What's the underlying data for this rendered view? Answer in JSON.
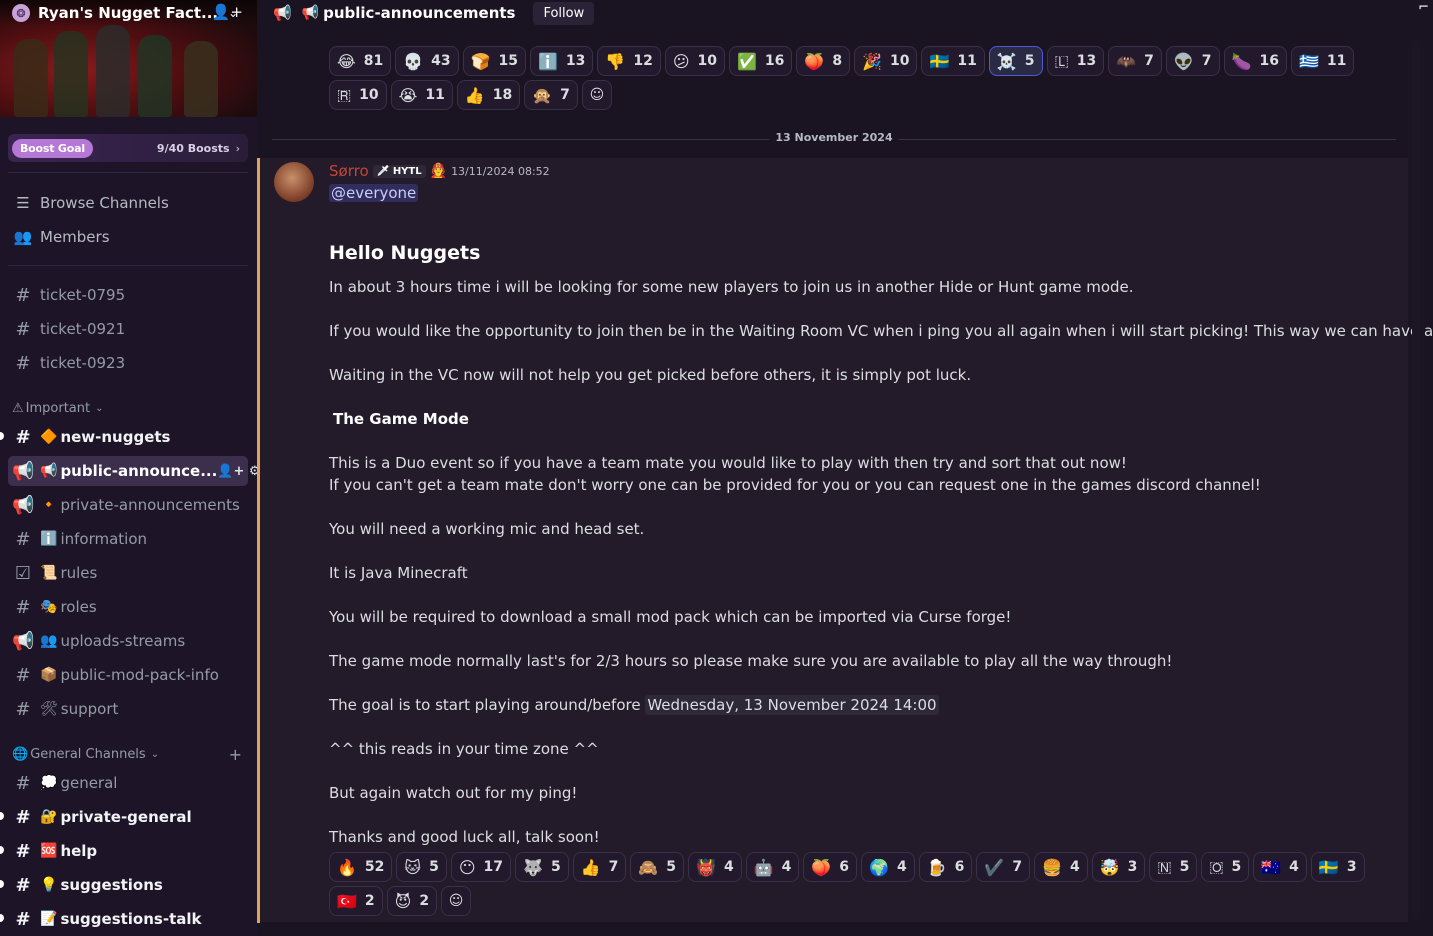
{
  "server": {
    "name": "Ryan's Nugget Fact...",
    "boost_pill": "Boost Goal",
    "boost_count": "9/40 Boosts"
  },
  "sidebar": {
    "browse": "Browse Channels",
    "members": "Members",
    "tickets": [
      "ticket-0795",
      "ticket-0921",
      "ticket-0923"
    ],
    "important_label": "Important",
    "important": [
      {
        "emoji": "🔶",
        "label": "new-nuggets"
      },
      {
        "emoji": "📢",
        "label": "public-announce..."
      },
      {
        "emoji": "🔸",
        "label": "private-announcements"
      },
      {
        "emoji": "ℹ️",
        "label": "information"
      },
      {
        "emoji": "📜",
        "label": "rules"
      },
      {
        "emoji": "🎭",
        "label": "roles"
      },
      {
        "emoji": "👥",
        "label": "uploads-streams"
      },
      {
        "emoji": "📦",
        "label": "public-mod-pack-info"
      },
      {
        "emoji": "🛠",
        "label": "support"
      }
    ],
    "general_label": "General Channels",
    "general": [
      {
        "emoji": "💭",
        "label": "general"
      },
      {
        "emoji": "🔐",
        "label": "private-general"
      },
      {
        "emoji": "🆘",
        "label": "help"
      },
      {
        "emoji": "💡",
        "label": "suggestions"
      },
      {
        "emoji": "📝",
        "label": "suggestions-talk"
      }
    ]
  },
  "topbar": {
    "channel": "public-announcements",
    "follow": "Follow"
  },
  "reactions_top": [
    {
      "emoji": "😂",
      "count": "81"
    },
    {
      "emoji": "💀",
      "count": "43"
    },
    {
      "emoji": "🍞",
      "count": "15"
    },
    {
      "emoji": "ℹ️",
      "count": "13"
    },
    {
      "emoji": "👎",
      "count": "12"
    },
    {
      "emoji": "😕",
      "count": "10"
    },
    {
      "emoji": "✅",
      "count": "16"
    },
    {
      "emoji": "🍑",
      "count": "8"
    },
    {
      "emoji": "🎉",
      "count": "10"
    },
    {
      "emoji": "🇸🇪",
      "count": "11"
    },
    {
      "emoji": "☠️",
      "count": "5",
      "me": true
    },
    {
      "emoji": "🇱",
      "count": "13"
    },
    {
      "emoji": "🦇",
      "count": "7"
    },
    {
      "emoji": "👽",
      "count": "7"
    },
    {
      "emoji": "🍆",
      "count": "16"
    },
    {
      "emoji": "🇬🇷",
      "count": "11"
    },
    {
      "emoji": "🇷",
      "count": "10"
    },
    {
      "emoji": "😭",
      "count": "11"
    },
    {
      "emoji": "👍",
      "count": "18"
    },
    {
      "emoji": "🙊",
      "count": "7"
    }
  ],
  "date_separator": "13 November 2024",
  "message": {
    "author": "Sørro",
    "tag": "HYTL",
    "timestamp": "13/11/2024 08:52",
    "mention": "@everyone",
    "heading": "Hello Nuggets",
    "line1": "In about 3 hours time i will be looking for some new players to join us in another Hide or Hunt game mode.",
    "line2": "If you would like the opportunity to join then be in the Waiting Room VC when i ping you all again when i will start picking! This way we can have a chat!",
    "line3": "Waiting in the VC now will not help you get picked before others, it is simply pot luck.",
    "subheading": "The Game Mode",
    "line4": "This is a Duo event so if you have a team mate you would like to play with then try and sort that out now!",
    "line5": "If you can't get a team mate don't worry one can be provided for you or you can request one in the games discord channel!",
    "line6": "You will need a working mic and head set.",
    "line7": "It is Java Minecraft",
    "line8": "You will be required to download a small mod pack which can be imported via Curse forge!",
    "line9": "The game mode normally last's for 2/3 hours so please make sure you are available to play all the way through!",
    "line10_prefix": "The goal is to start playing around/before",
    "line10_time": "Wednesday, 13 November 2024 14:00",
    "line11": "^^ this reads in your time zone ^^",
    "line12": "But again watch out for my ping!",
    "line13": "Thanks and good luck all, talk soon!"
  },
  "reactions_bottom": [
    {
      "emoji": "🔥",
      "count": "52"
    },
    {
      "emoji": "🐱",
      "count": "5"
    },
    {
      "emoji": "😶",
      "count": "17"
    },
    {
      "emoji": "🐺",
      "count": "5"
    },
    {
      "emoji": "👍",
      "count": "7"
    },
    {
      "emoji": "🙈",
      "count": "5"
    },
    {
      "emoji": "👹",
      "count": "4"
    },
    {
      "emoji": "🤖",
      "count": "4"
    },
    {
      "emoji": "🍑",
      "count": "6"
    },
    {
      "emoji": "🌍",
      "count": "4"
    },
    {
      "emoji": "🍺",
      "count": "6"
    },
    {
      "emoji": "✔️",
      "count": "7"
    },
    {
      "emoji": "🍔",
      "count": "4"
    },
    {
      "emoji": "🤯",
      "count": "3"
    },
    {
      "emoji": "🇳",
      "count": "5"
    },
    {
      "emoji": "🇴",
      "count": "5"
    },
    {
      "emoji": "🇦🇺",
      "count": "4"
    },
    {
      "emoji": "🇸🇪",
      "count": "3"
    },
    {
      "emoji": "🇹🇷",
      "count": "2"
    },
    {
      "emoji": "😈",
      "count": "2"
    }
  ]
}
